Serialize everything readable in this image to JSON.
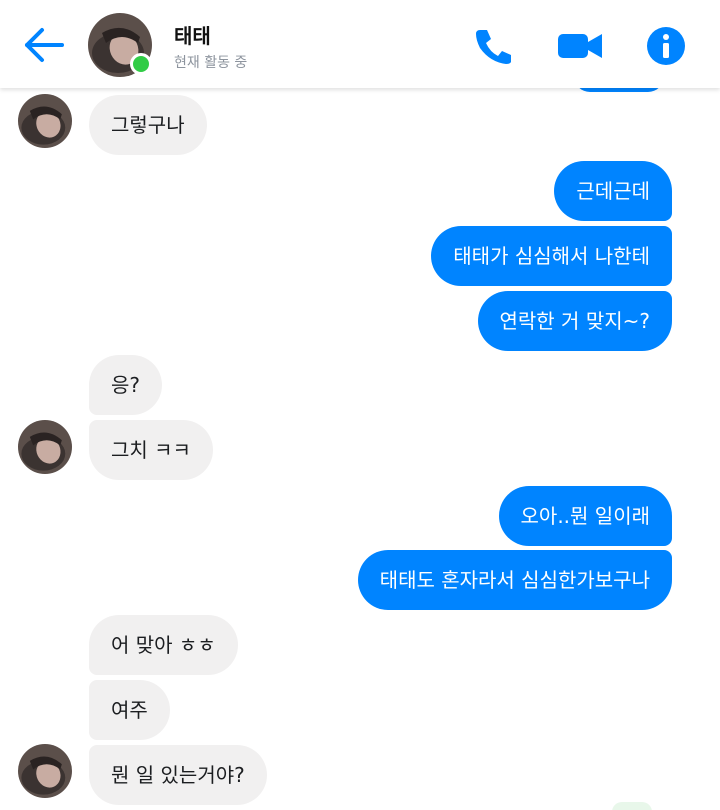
{
  "header": {
    "contact_name": "태태",
    "status": "현재 활동 중"
  },
  "colors": {
    "accent": "#0084ff",
    "incoming_bubble": "#f1f0f0",
    "online": "#31cc46"
  },
  "icons": {
    "back": "arrow-left-icon",
    "call": "phone-icon",
    "video": "video-camera-icon",
    "info": "info-icon"
  },
  "messages": [
    {
      "side": "in",
      "text": "그렇구나"
    },
    {
      "side": "out",
      "text": "근데근데"
    },
    {
      "side": "out",
      "text": "태태가 심심해서 나한테"
    },
    {
      "side": "out",
      "text": "연락한 거 맞지~?"
    },
    {
      "side": "in",
      "text": "응?"
    },
    {
      "side": "in",
      "text": "그치 ㅋㅋ"
    },
    {
      "side": "out",
      "text": "오아..뭔 일이래"
    },
    {
      "side": "out",
      "text": "태태도 혼자라서 심심한가보구나"
    },
    {
      "side": "in",
      "text": "어 맞아 ㅎㅎ"
    },
    {
      "side": "in",
      "text": "여주"
    },
    {
      "side": "in",
      "text": "뭔 일 있는거야?"
    }
  ]
}
